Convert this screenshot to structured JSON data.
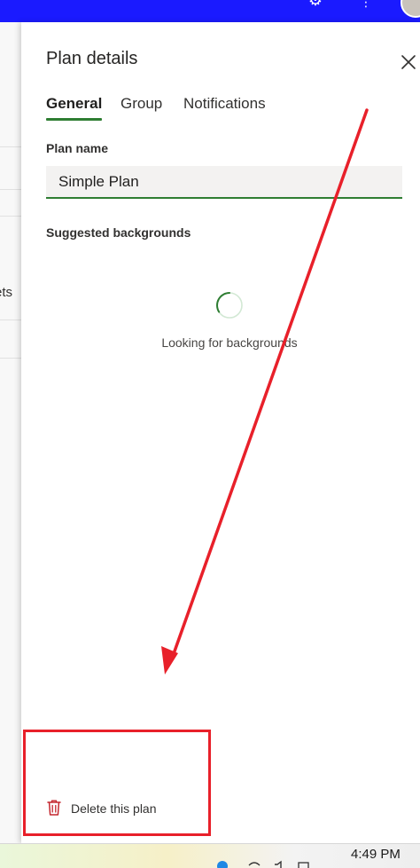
{
  "panel": {
    "title": "Plan details",
    "tabs": [
      {
        "label": "General",
        "active": true
      },
      {
        "label": "Group",
        "active": false
      },
      {
        "label": "Notifications",
        "active": false
      }
    ],
    "plan_name_label": "Plan name",
    "plan_name_value": "Simple Plan",
    "suggested_label": "Suggested backgrounds",
    "loading_text": "Looking for backgrounds",
    "delete_label": "Delete this plan"
  },
  "background_page": {
    "partial_text": "ets"
  },
  "taskbar": {
    "clock": "4:49 PM"
  },
  "colors": {
    "app_bar": "#1a1aff",
    "accent": "#2e7d32",
    "annotation": "#e8202a",
    "delete_icon": "#c4262e"
  },
  "icons": {
    "settings": "gear-icon",
    "more": "more-vertical-icon",
    "close": "close-icon",
    "delete": "trash-icon",
    "loading": "spinner-icon"
  }
}
